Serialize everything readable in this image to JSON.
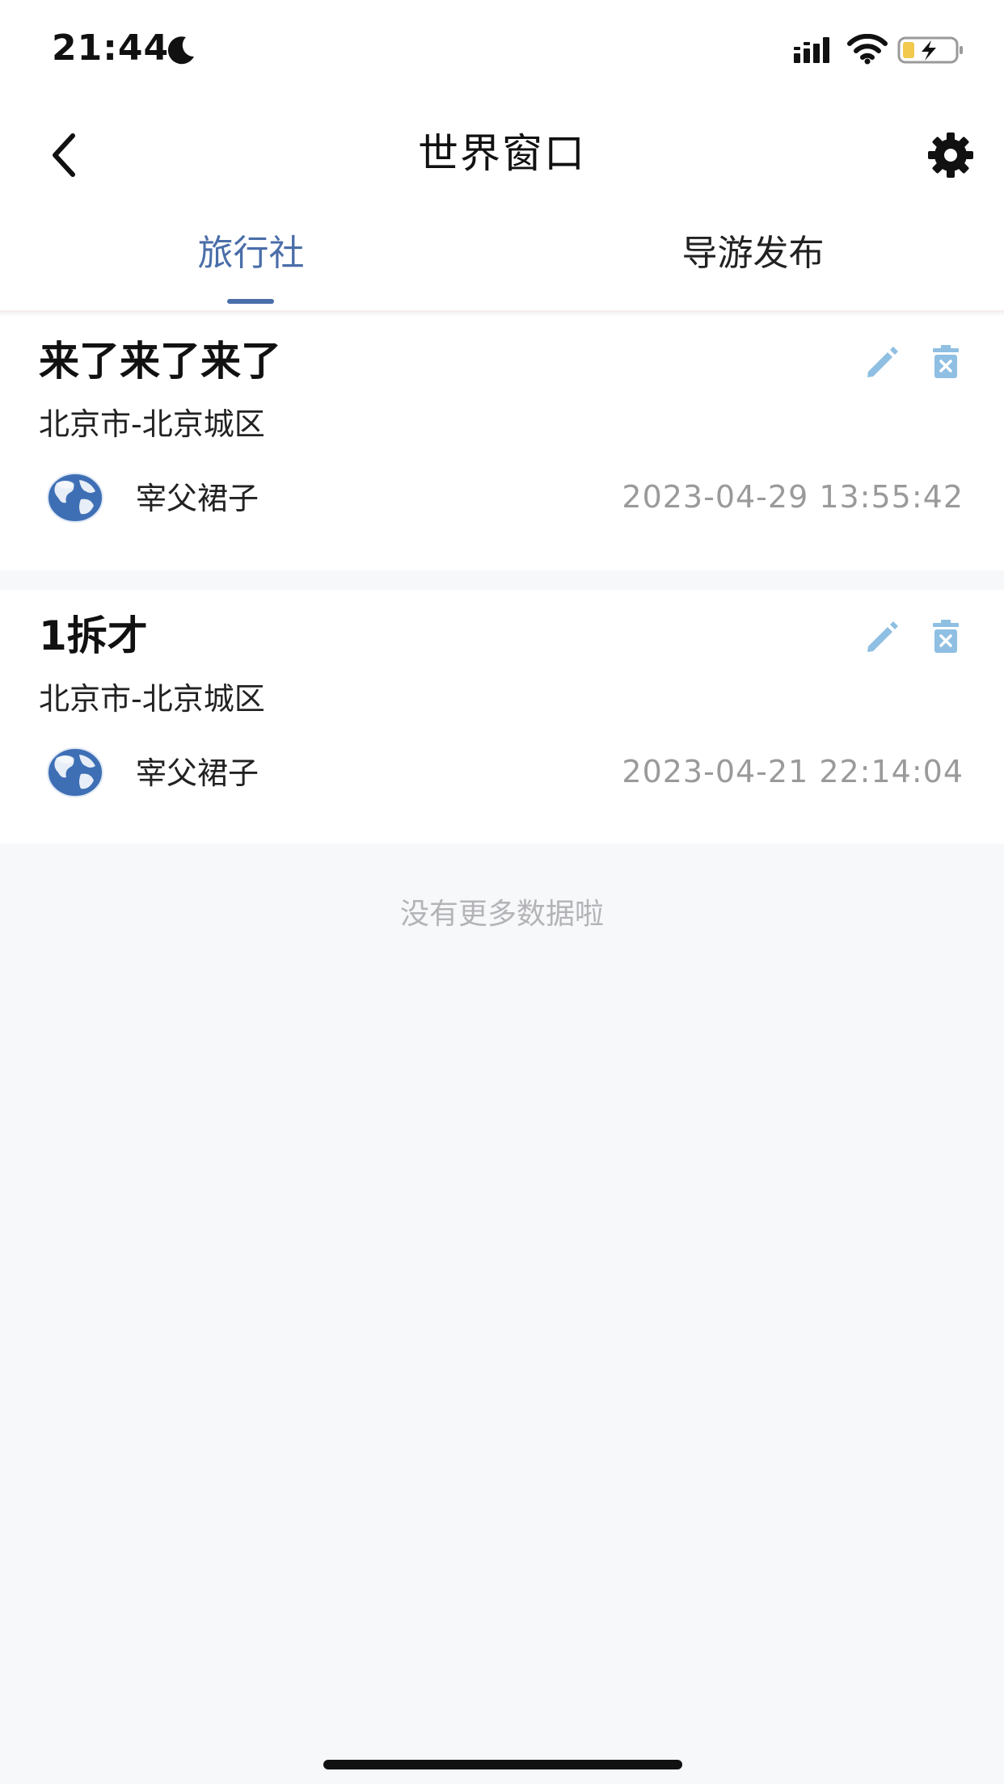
{
  "status_bar": {
    "time": "21:44",
    "icons": [
      "moon-icon",
      "signal-icon",
      "wifi-icon",
      "battery-charging-icon"
    ]
  },
  "header": {
    "title": "世界窗口",
    "back_icon": "chevron-left-icon",
    "settings_icon": "gear-icon"
  },
  "tabs": [
    {
      "label": "旅行社",
      "active": true
    },
    {
      "label": "导游发布",
      "active": false
    }
  ],
  "items": [
    {
      "title": "来了来了来了",
      "location": "北京市-北京城区",
      "author": "宰父裙子",
      "time": "2023-04-29 13:55:42",
      "avatar_icon": "globe-icon"
    },
    {
      "title": "1拆才",
      "location": "北京市-北京城区",
      "author": "宰父裙子",
      "time": "2023-04-21 22:14:04",
      "avatar_icon": "globe-icon"
    }
  ],
  "footer_text": "没有更多数据啦",
  "colors": {
    "accent": "#4a6ea9",
    "action_icon": "#8fbfe2",
    "background": "#f7f8fa",
    "muted_text": "#9a9a9a"
  }
}
